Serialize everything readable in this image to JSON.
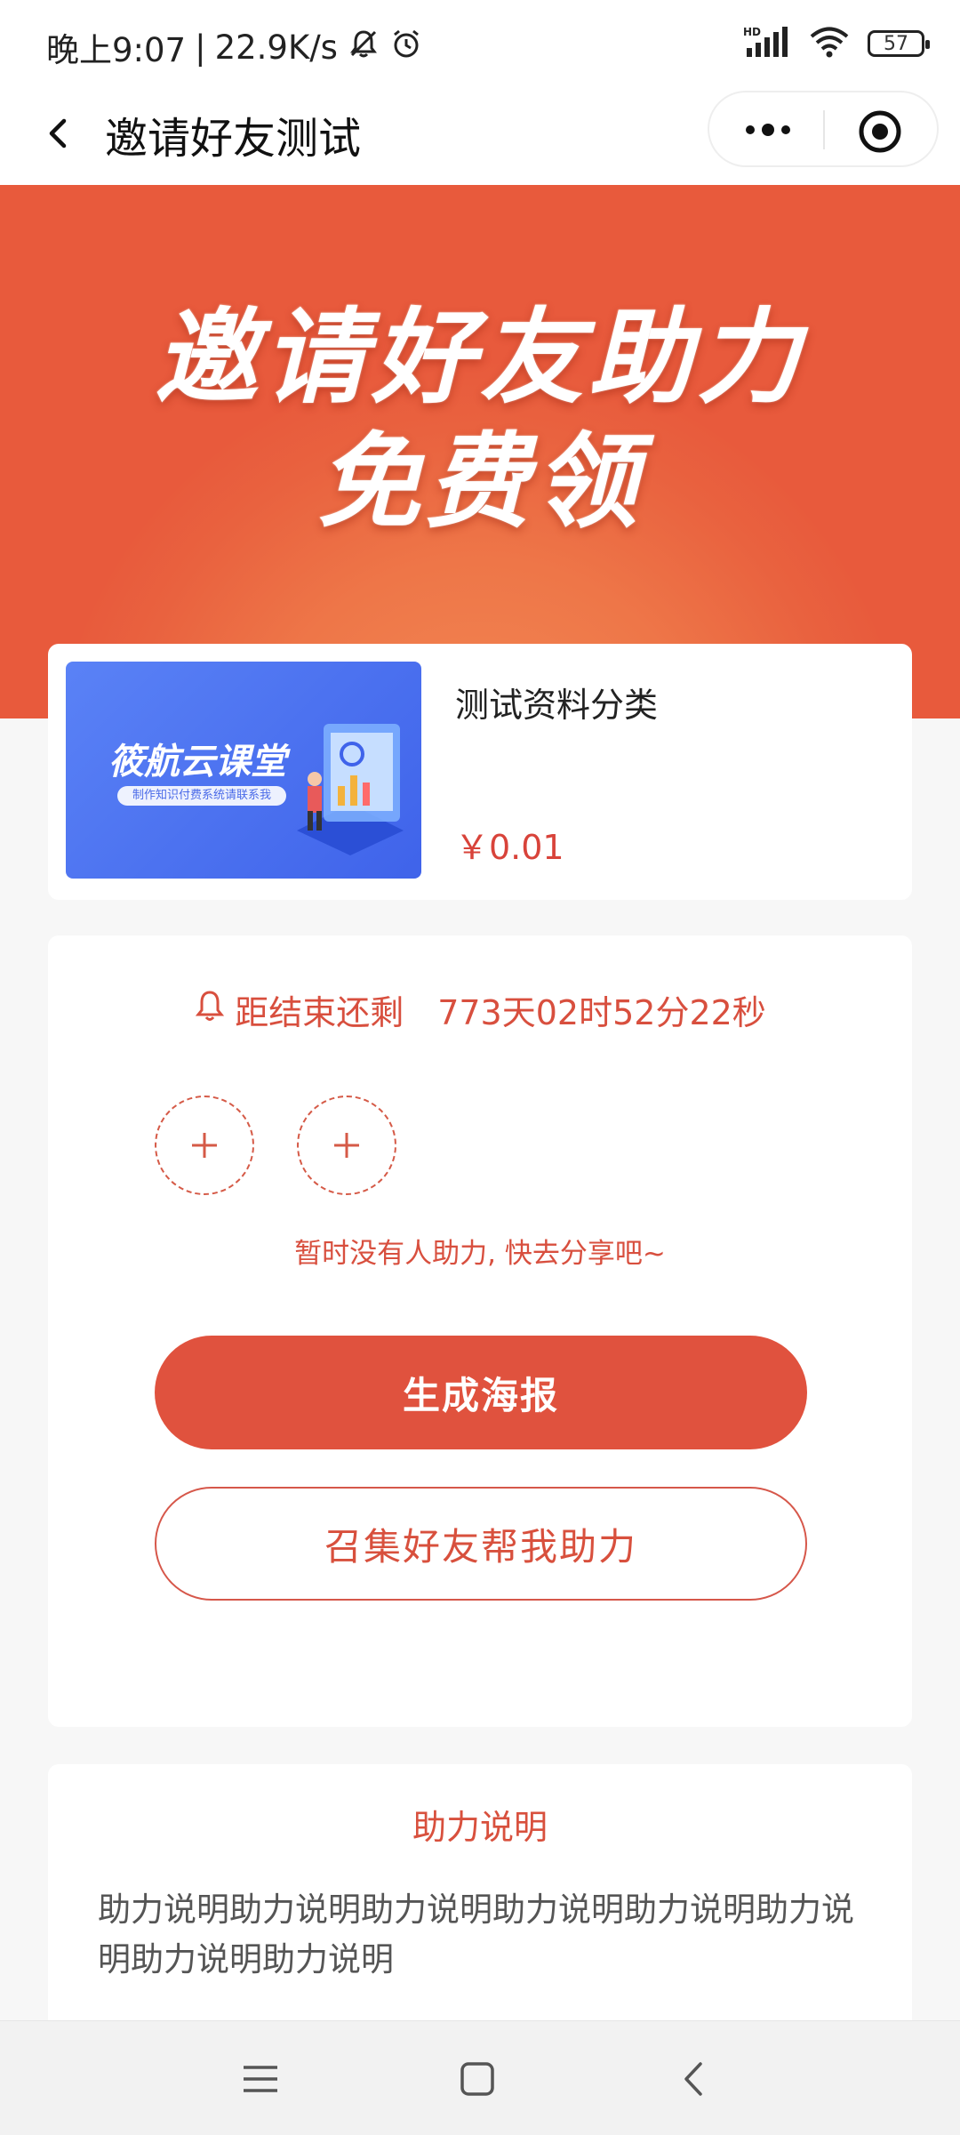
{
  "status_bar": {
    "time": "晚上9:07",
    "separator": "|",
    "net_speed": "22.9K/s",
    "signal_label": "HD",
    "battery": "57",
    "icons": [
      "bell-muted-icon",
      "alarm-icon",
      "signal-icon",
      "wifi-icon",
      "battery-icon"
    ]
  },
  "nav": {
    "title": "邀请好友测试",
    "icons": [
      "back-icon",
      "more-dots-icon",
      "target-icon"
    ]
  },
  "hero": {
    "line1": "邀请好友助力",
    "line2": "免费领",
    "colors": {
      "background": "#e85a3c",
      "glow": "#f38a55"
    }
  },
  "product": {
    "image_brand": "筱航云课堂",
    "image_tagline": "制作知识付费系统请联系我",
    "name": "测试资料分类",
    "price": "￥0.01"
  },
  "assist": {
    "countdown_label": "距结束还剩",
    "countdown_value": "773天02时52分22秒",
    "slot_icon": "plus-icon",
    "hint": "暂时没有人助力, 快去分享吧~",
    "primary_button": "生成海报",
    "secondary_button": "召集好友帮我助力"
  },
  "explain": {
    "title": "助力说明",
    "body": "助力说明助力说明助力说明助力说明助力说明助力说明助力说明助力说明"
  },
  "system_nav": {
    "icons": [
      "menu-icon",
      "home-icon",
      "back-triangle-icon"
    ]
  },
  "colors": {
    "accent": "#e0523e",
    "accent_text": "#d84f3e",
    "page_bg": "#f7f7f7"
  }
}
